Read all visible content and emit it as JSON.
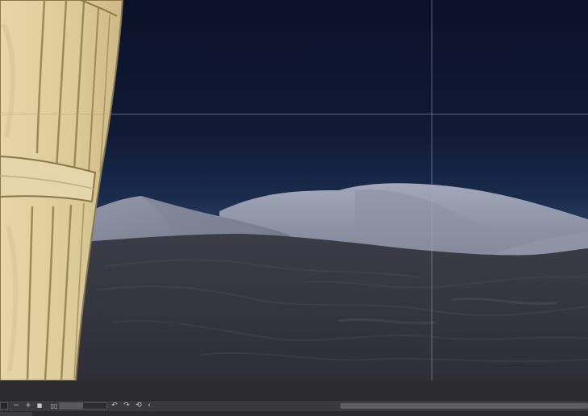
{
  "colors": {
    "sky_top": "#0e1429",
    "sky_horizon": "#2a4266",
    "dune_far": "#8d93a4",
    "dune_mid": "#6c7182",
    "dune_near": "#34353f",
    "scroll_sand": "#e3d3a4",
    "scroll_sand_shadow": "#c9b47f",
    "scroll_outline": "#8a7648",
    "guide": "#a0aabe",
    "ui_panel": "#3a3a3c"
  },
  "view": {
    "zoom_level": 0.5
  },
  "toolbar": {
    "zoom_out_symbol": "−",
    "zoom_in_symbol": "+",
    "fit_symbol": "■",
    "actual_size_symbol": "▯▯",
    "rotate_left_symbol": "↶",
    "rotate_right_symbol": "↷",
    "reset_rotation_symbol": "⟲",
    "flip_symbol": "‹"
  },
  "icons": {
    "zoom_out": "minus-icon",
    "zoom_in": "plus-icon",
    "fit": "square-icon",
    "actual_size": "actual-size-icon",
    "rotate_left": "rotate-left-icon",
    "rotate_right": "rotate-right-icon",
    "reset_rotation": "reset-rotation-icon",
    "flip": "chevron-left-icon"
  }
}
